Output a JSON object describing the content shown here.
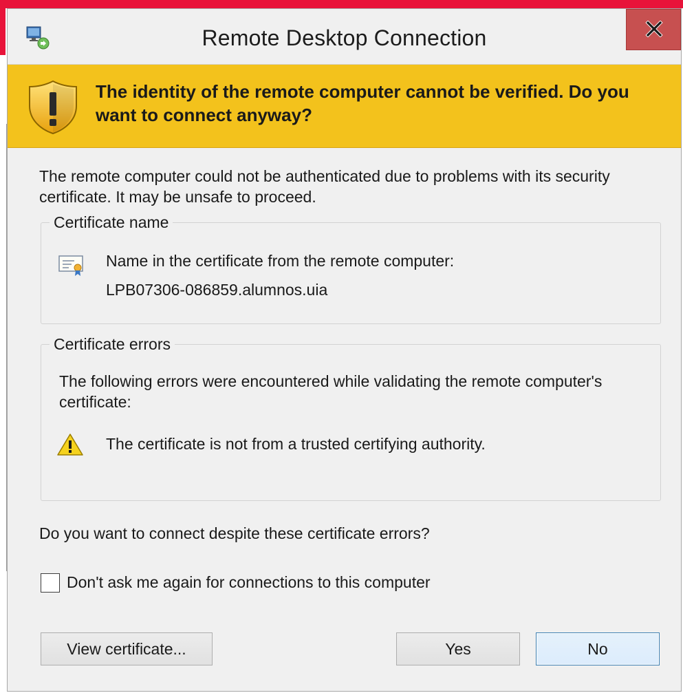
{
  "window": {
    "title": "Remote Desktop Connection",
    "close_glyph": "x"
  },
  "warning": {
    "headline": "The identity of the remote computer cannot be verified. Do you want to connect anyway?",
    "band_color": "#f3c21c"
  },
  "intro": "The remote computer could not be authenticated due to problems with its security certificate. It may be unsafe to proceed.",
  "certificate_name": {
    "group_label": "Certificate name",
    "line1": "Name in the certificate from the remote computer:",
    "line2": "LPB07306-086859.alumnos.uia",
    "icon": "certificate-icon"
  },
  "certificate_errors": {
    "group_label": "Certificate errors",
    "description": "The following errors were encountered while validating the remote computer's certificate:",
    "items": [
      {
        "icon": "warning-triangle-icon",
        "text": "The certificate is not from a trusted certifying authority."
      }
    ]
  },
  "question": "Do you want to connect despite these certificate errors?",
  "dont_ask": {
    "label": "Don't ask me again for connections to this computer",
    "checked": false
  },
  "buttons": {
    "view_certificate": "View certificate...",
    "yes": "Yes",
    "no": "No"
  },
  "colors": {
    "close_button": "#c75050",
    "default_button_border": "#3c7fb1",
    "background_accent": "#e8133a"
  }
}
